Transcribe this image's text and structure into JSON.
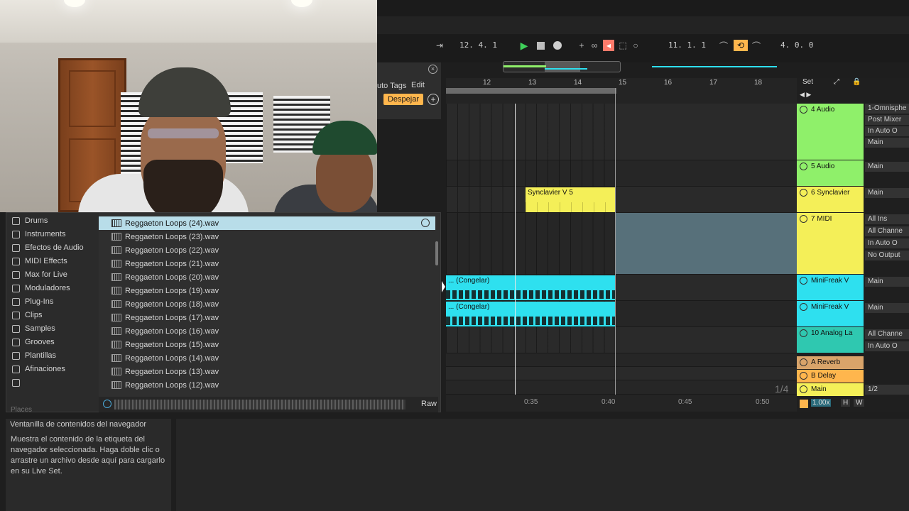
{
  "transport": {
    "position_left": "12.  4.  1",
    "position_right": "11.  1.  1",
    "loop_length": "4.  0.  0"
  },
  "browser_header": {
    "tags_label": "uto Tags",
    "edit_label": "Edit",
    "clear_button": "Despejar"
  },
  "places": [
    {
      "label": "Drums",
      "icon": "drums-icon"
    },
    {
      "label": "Instruments",
      "icon": "instruments-icon"
    },
    {
      "label": "Efectos de Audio",
      "icon": "audio-effects-icon"
    },
    {
      "label": "MIDI Effects",
      "icon": "midi-effects-icon"
    },
    {
      "label": "Max for Live",
      "icon": "max-for-live-icon"
    },
    {
      "label": "Moduladores",
      "icon": "modulators-icon"
    },
    {
      "label": "Plug-Ins",
      "icon": "plugins-icon"
    },
    {
      "label": "Clips",
      "icon": "clips-icon"
    },
    {
      "label": "Samples",
      "icon": "samples-icon"
    },
    {
      "label": "Grooves",
      "icon": "grooves-icon"
    },
    {
      "label": "Plantillas",
      "icon": "templates-icon"
    },
    {
      "label": "Afinaciones",
      "icon": "tunings-icon"
    }
  ],
  "places_label": "Places",
  "files": [
    "Reggaeton Loops (24).wav",
    "Reggaeton Loops (23).wav",
    "Reggaeton Loops (22).wav",
    "Reggaeton Loops (21).wav",
    "Reggaeton Loops (20).wav",
    "Reggaeton Loops (19).wav",
    "Reggaeton Loops (18).wav",
    "Reggaeton Loops (17).wav",
    "Reggaeton Loops (16).wav",
    "Reggaeton Loops (15).wav",
    "Reggaeton Loops (14).wav",
    "Reggaeton Loops (13).wav",
    "Reggaeton Loops (12).wav"
  ],
  "preview": {
    "raw_label": "Raw"
  },
  "ruler_bars": [
    "12",
    "13",
    "14",
    "15",
    "16",
    "17",
    "18"
  ],
  "timeline": [
    "0:35",
    "0:40",
    "0:45",
    "0:50"
  ],
  "clips": {
    "synclavier": "Synclavier V 5",
    "congelar_1": "... (Congelar)",
    "congelar_2": "... (Congelar)"
  },
  "page_indicator": "1/4",
  "tracks": [
    {
      "name": "4 Audio",
      "color": "#8ff06a",
      "io": [
        "1-Omnisphe",
        "Post Mixer",
        "In  Auto  O",
        "Main"
      ]
    },
    {
      "name": "5 Audio",
      "color": "#8ff06a",
      "io": [
        "Main"
      ]
    },
    {
      "name": "6 Synclavier",
      "color": "#f4ef58",
      "io": [
        "Main"
      ]
    },
    {
      "name": "7 MIDI",
      "color": "#f4ef58",
      "io": [
        "All Ins",
        "All Channe",
        "In  Auto  O",
        "No Output"
      ]
    },
    {
      "name": "MiniFreak V",
      "color": "#2ee0ef",
      "io": [
        "Main"
      ]
    },
    {
      "name": "MiniFreak V",
      "color": "#2ee0ef",
      "io": [
        "Main"
      ]
    },
    {
      "name": "10 Analog La",
      "color": "#2fc8b0",
      "io": [
        "All Channe",
        "In  Auto  O"
      ]
    },
    {
      "name": "A Reverb",
      "color": "#d9a46a",
      "io": []
    },
    {
      "name": "B Delay",
      "color": "#ffb64d",
      "io": []
    },
    {
      "name": "Main",
      "color": "#f4ef58",
      "io": [
        "1/2"
      ]
    }
  ],
  "set_label": "Set",
  "bottom_ctrl": {
    "zoom": "1.00x",
    "h": "H",
    "w": "W"
  },
  "info": {
    "title": "Ventanilla de contenidos del navegador",
    "body": "Muestra el contenido de la etiqueta del navegador seleccionada. Haga doble clic o arrastre un archivo desde aquí para cargarlo en su Live Set."
  },
  "colors": {
    "accent_orange": "#ffb64d",
    "selection_blue": "#b8dde9",
    "play_green": "#3fd05a"
  }
}
